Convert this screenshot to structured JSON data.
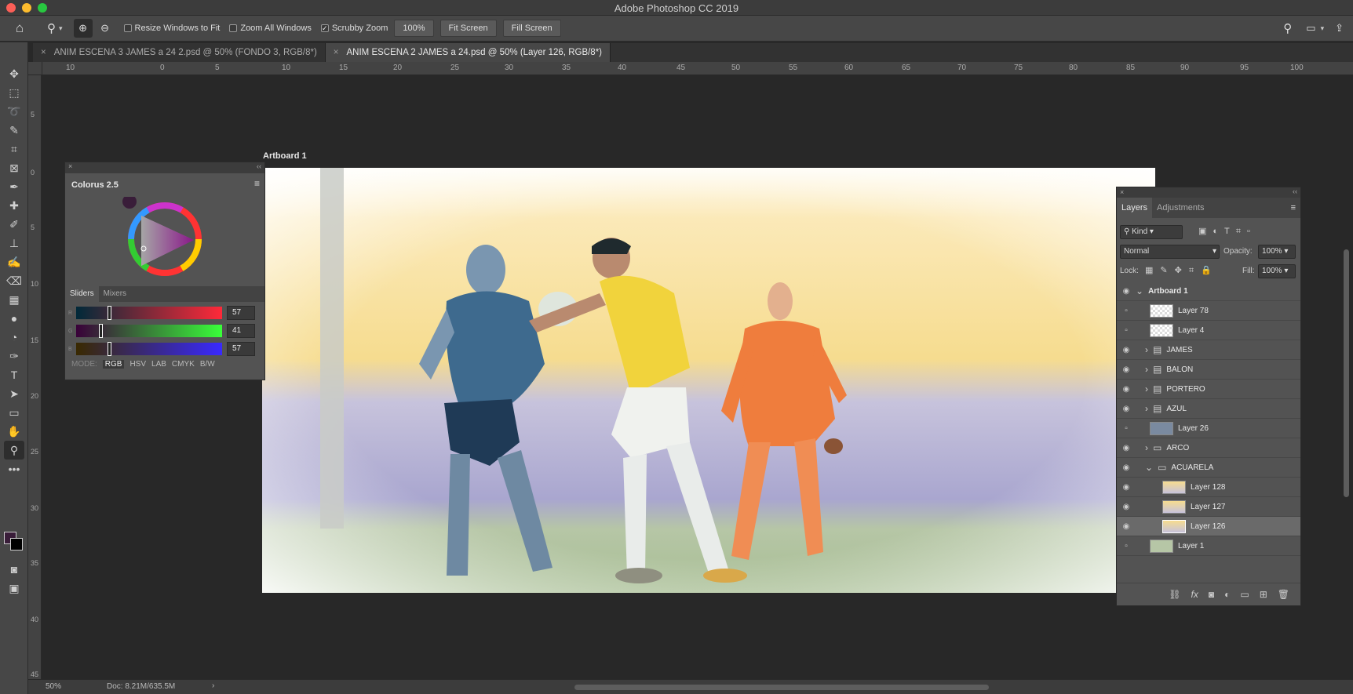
{
  "app": {
    "title": "Adobe Photoshop CC 2019"
  },
  "options_bar": {
    "resize_windows": "Resize Windows to Fit",
    "zoom_all": "Zoom All Windows",
    "scrubby_zoom": "Scrubby Zoom",
    "zoom_value": "100%",
    "fit_screen": "Fit Screen",
    "fill_screen": "Fill Screen"
  },
  "documents": [
    {
      "title": "ANIM ESCENA 3 JAMES a 24 2.psd @ 50% (FONDO 3, RGB/8*)"
    },
    {
      "title": "ANIM ESCENA 2 JAMES a 24.psd @ 50% (Layer 126, RGB/8*)"
    }
  ],
  "ruler_top": [
    "10",
    "0",
    "5",
    "10",
    "15",
    "20",
    "25",
    "30",
    "35",
    "40",
    "45",
    "50",
    "55",
    "60",
    "65",
    "70",
    "75",
    "80",
    "85",
    "90",
    "95",
    "100"
  ],
  "ruler_left": [
    "5",
    "0",
    "5",
    "10",
    "15",
    "20",
    "25",
    "30",
    "35",
    "40",
    "45"
  ],
  "artboard": {
    "label": "Artboard 1"
  },
  "colorus": {
    "title": "Colorus 2.5",
    "tab_sliders": "Sliders",
    "tab_mixers": "Mixers",
    "r_label": "R",
    "r_value": "57",
    "g_label": "G",
    "g_value": "41",
    "b_label": "B",
    "b_value": "57",
    "mode_label": "MODE:",
    "modes": [
      "RGB",
      "HSV",
      "LAB",
      "CMYK",
      "B/W"
    ]
  },
  "layers_panel": {
    "tab_layers": "Layers",
    "tab_adjustments": "Adjustments",
    "kind": "Kind",
    "blend": "Normal",
    "opacity_label": "Opacity:",
    "opacity": "100%",
    "lock_label": "Lock:",
    "fill_label": "Fill:",
    "fill": "100%",
    "rows": [
      {
        "name": "Artboard 1"
      },
      {
        "name": "Layer 78"
      },
      {
        "name": "Layer 4"
      },
      {
        "name": "JAMES"
      },
      {
        "name": "BALON"
      },
      {
        "name": "PORTERO"
      },
      {
        "name": "AZUL"
      },
      {
        "name": "Layer 26"
      },
      {
        "name": "ARCO"
      },
      {
        "name": "ACUARELA"
      },
      {
        "name": "Layer 128"
      },
      {
        "name": "Layer 127"
      },
      {
        "name": "Layer 126"
      },
      {
        "name": "Layer 1"
      }
    ]
  },
  "status": {
    "zoom": "50%",
    "doc": "Doc: 8.21M/635.5M"
  }
}
